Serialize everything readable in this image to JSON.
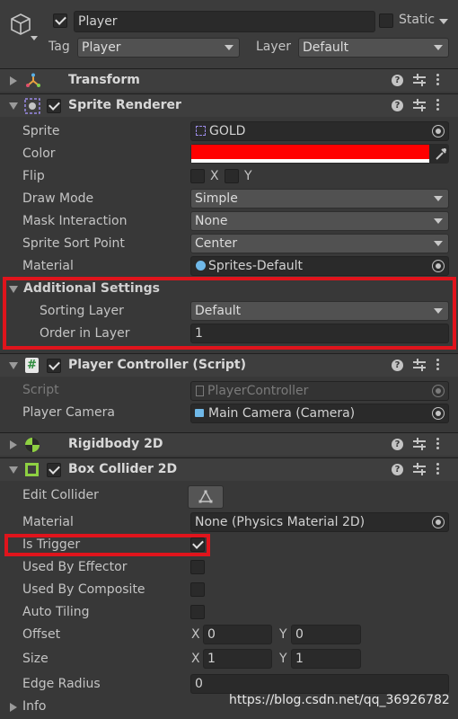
{
  "gameobject": {
    "enabled": true,
    "name": "Player",
    "static_label": "Static",
    "tag_label": "Tag",
    "tag_value": "Player",
    "layer_label": "Layer",
    "layer_value": "Default"
  },
  "components": {
    "transform": {
      "title": "Transform"
    },
    "sprite_renderer": {
      "title": "Sprite Renderer",
      "enabled": true,
      "sprite_label": "Sprite",
      "sprite_value": "GOLD",
      "color_label": "Color",
      "color_value": "#ff0000",
      "flip_label": "Flip",
      "flip_x": "X",
      "flip_y": "Y",
      "draw_mode_label": "Draw Mode",
      "draw_mode_value": "Simple",
      "mask_label": "Mask Interaction",
      "mask_value": "None",
      "sort_point_label": "Sprite Sort Point",
      "sort_point_value": "Center",
      "material_label": "Material",
      "material_value": "Sprites-Default",
      "additional_settings": {
        "title": "Additional Settings",
        "sorting_layer_label": "Sorting Layer",
        "sorting_layer_value": "Default",
        "order_label": "Order in Layer",
        "order_value": "1"
      }
    },
    "player_controller": {
      "title": "Player Controller (Script)",
      "enabled": true,
      "script_label": "Script",
      "script_value": "PlayerController",
      "camera_label": "Player Camera",
      "camera_value": "Main Camera (Camera)"
    },
    "rigidbody": {
      "title": "Rigidbody 2D"
    },
    "box_collider": {
      "title": "Box Collider 2D",
      "enabled": true,
      "edit_collider_label": "Edit Collider",
      "material_label": "Material",
      "material_value": "None (Physics Material 2D)",
      "is_trigger_label": "Is Trigger",
      "is_trigger": true,
      "used_by_effector_label": "Used By Effector",
      "used_by_effector": false,
      "used_by_composite_label": "Used By Composite",
      "used_by_composite": false,
      "auto_tiling_label": "Auto Tiling",
      "auto_tiling": false,
      "offset_label": "Offset",
      "offset_x_label": "X",
      "offset_x": "0",
      "offset_y_label": "Y",
      "offset_y": "0",
      "size_label": "Size",
      "size_x_label": "X",
      "size_x": "1",
      "size_y_label": "Y",
      "size_y": "1",
      "edge_radius_label": "Edge Radius",
      "edge_radius": "0"
    }
  },
  "info_label": "Info",
  "watermark": "https://blog.csdn.net/qq_36926782",
  "colors": {
    "highlight_box": "#e0141c",
    "panel_bg": "#383838"
  }
}
